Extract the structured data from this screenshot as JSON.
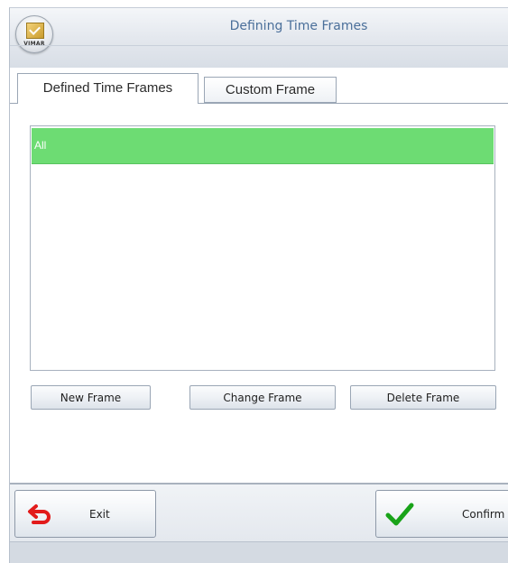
{
  "window": {
    "title": "Defining Time Frames",
    "logo_text": "VIMAR"
  },
  "tabs": [
    {
      "label": "Defined Time Frames",
      "active": true
    },
    {
      "label": "Custom Frame",
      "active": false
    }
  ],
  "time_frames": {
    "items": [
      {
        "label": "All",
        "selected": true
      }
    ],
    "selected_color": "#6ddc73"
  },
  "actions": {
    "new_label": "New Frame",
    "change_label": "Change Frame",
    "delete_label": "Delete Frame"
  },
  "footer": {
    "exit_label": "Exit",
    "exit_icon": "exit-arrow-icon",
    "confirm_label": "Confirm",
    "confirm_icon": "checkmark-icon"
  },
  "colors": {
    "title_text": "#4a6f9a",
    "exit_icon": "#e21b1b",
    "confirm_icon": "#19a319"
  }
}
